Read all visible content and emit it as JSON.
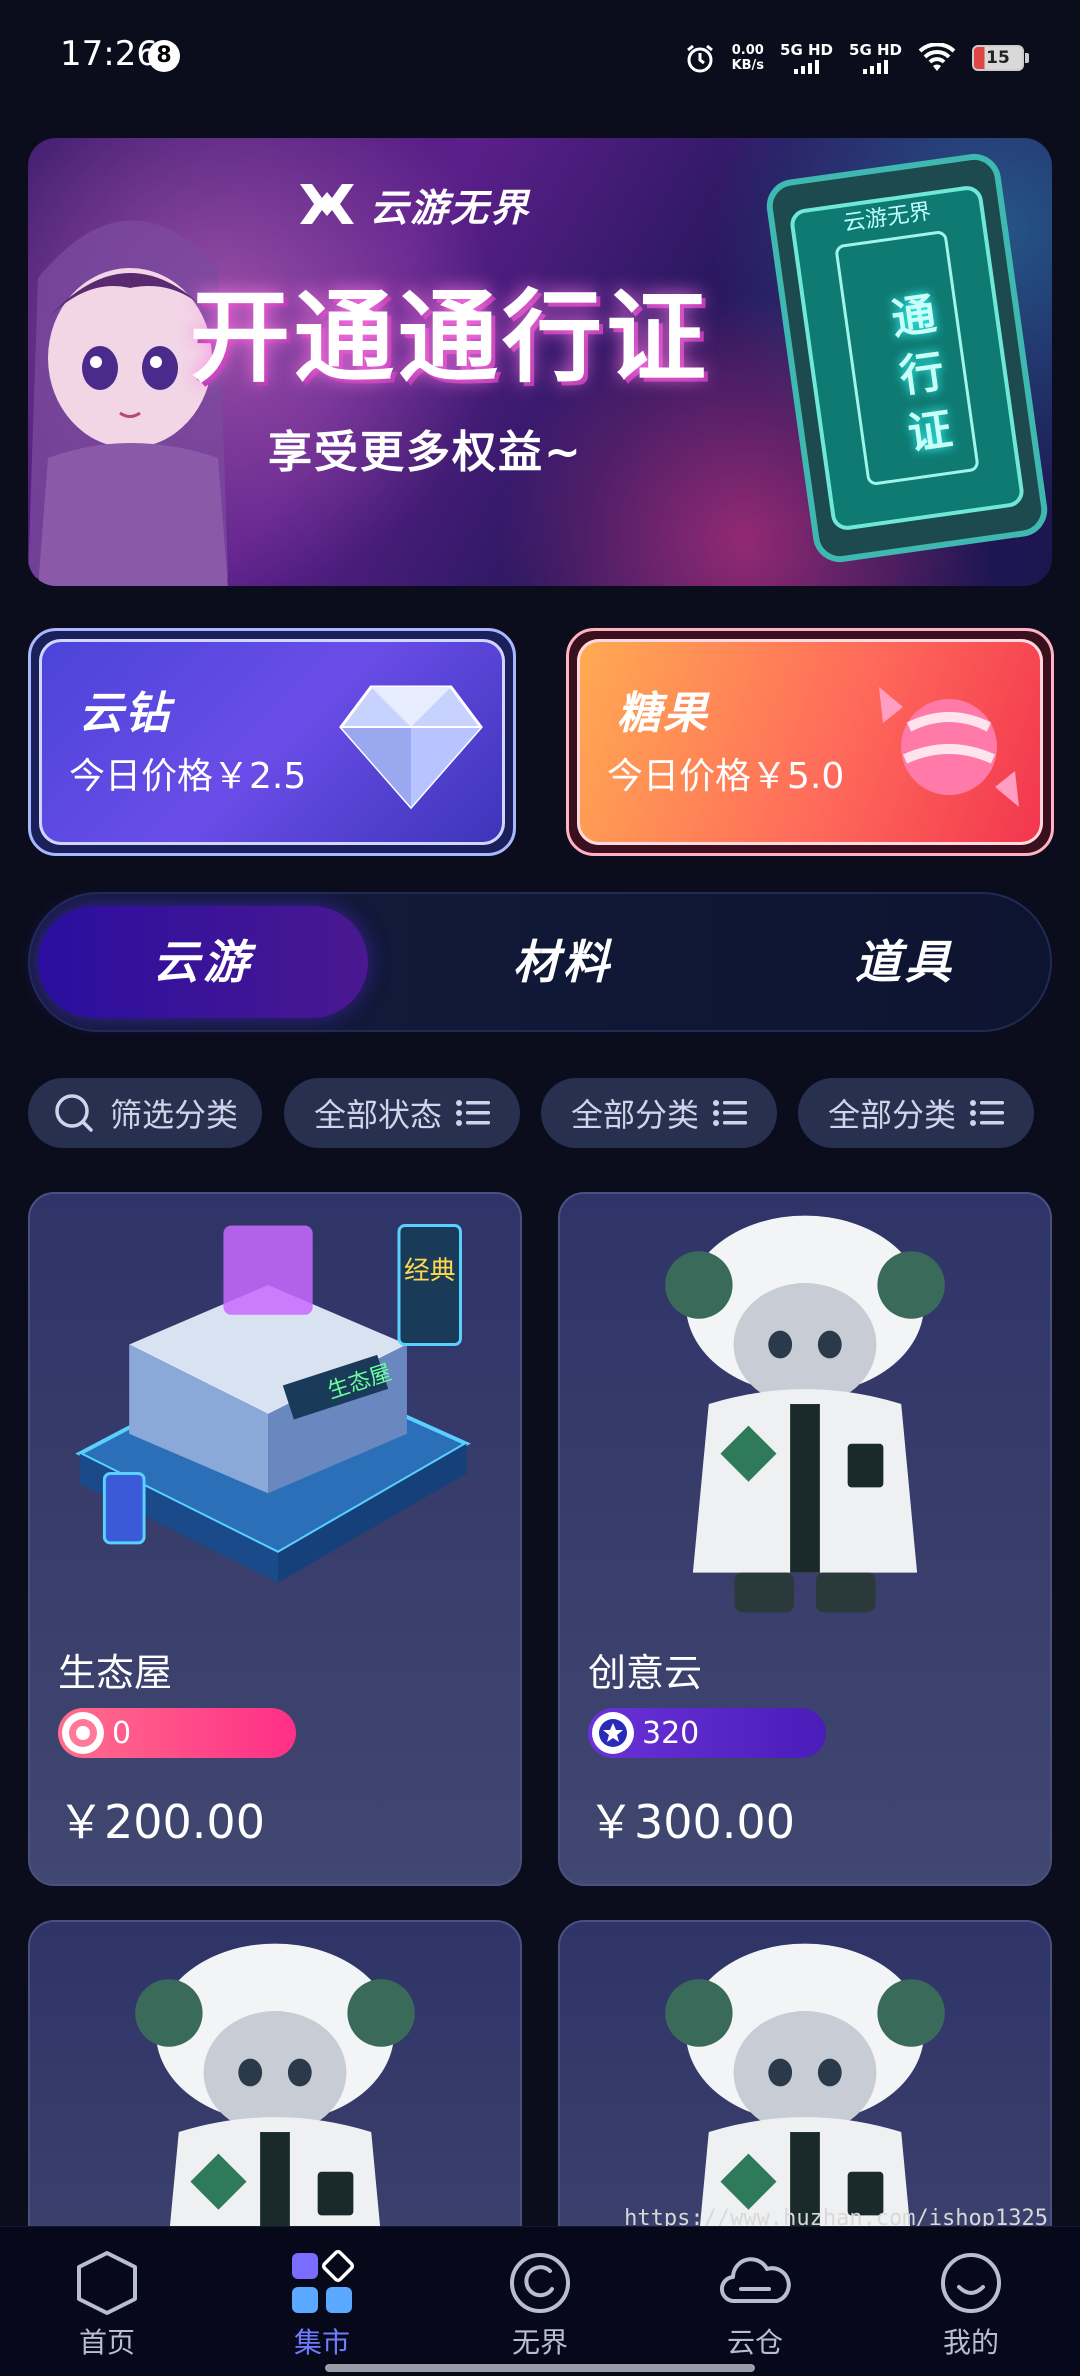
{
  "status_bar": {
    "time": "17:26",
    "notification_count": "8",
    "net_speed_value": "0.00",
    "net_speed_unit": "KB/s",
    "signal1_label": "5G HD",
    "signal2_label": "5G HD",
    "battery": "15"
  },
  "banner": {
    "logo_text": "云游无界",
    "title": "开通通行证",
    "subtitle": "享受更多权益~",
    "pass_card_text": "通行证",
    "pass_card_brand": "云游无界"
  },
  "price_cards": [
    {
      "title": "云钻",
      "price": "今日价格￥2.5",
      "icon": "diamond-icon"
    },
    {
      "title": "糖果",
      "price": "今日价格￥5.0",
      "icon": "candy-icon"
    }
  ],
  "tabs": [
    {
      "label": "云游",
      "active": true
    },
    {
      "label": "材料",
      "active": false
    },
    {
      "label": "道具",
      "active": false
    }
  ],
  "filters": [
    {
      "label": "筛选分类",
      "icon": "search-icon"
    },
    {
      "label": "全部状态",
      "icon": "list-icon"
    },
    {
      "label": "全部分类",
      "icon": "list-icon"
    },
    {
      "label": "全部分类",
      "icon": "list-icon"
    }
  ],
  "products": [
    {
      "name": "生态屋",
      "badge_value": "0",
      "badge_style": "pink",
      "price": "￥200.00",
      "image_text_1": "生态屋",
      "image_text_2": "经典"
    },
    {
      "name": "创意云",
      "badge_value": "320",
      "badge_style": "purple",
      "price": "￥300.00"
    },
    {
      "name": "",
      "badge_value": "",
      "price": ""
    },
    {
      "name": "",
      "badge_value": "",
      "price": ""
    }
  ],
  "bottom_nav": [
    {
      "label": "首页",
      "icon": "hexagon-icon",
      "active": false
    },
    {
      "label": "集市",
      "icon": "market-grid-icon",
      "active": true
    },
    {
      "label": "无界",
      "icon": "swirl-icon",
      "active": false
    },
    {
      "label": "云仓",
      "icon": "cloud-icon",
      "active": false
    },
    {
      "label": "我的",
      "icon": "smile-icon",
      "active": false
    }
  ],
  "watermark": "https://www.huzhan.com/ishop1325",
  "colors": {
    "background": "#0b0d1c",
    "accent": "#6e7cff",
    "badge_pink": "#ff2e88",
    "badge_purple": "#5a28c8"
  }
}
